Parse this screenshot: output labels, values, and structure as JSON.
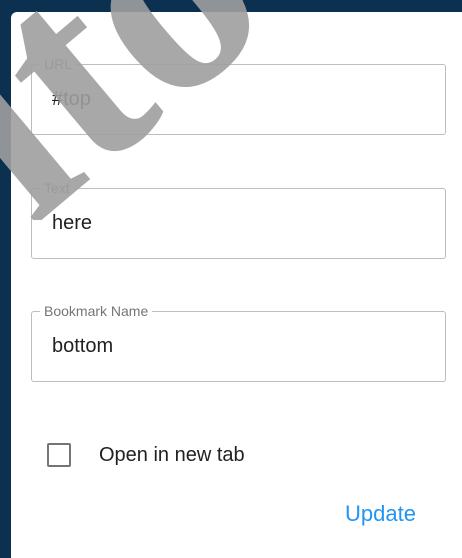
{
  "dialog": {
    "fields": [
      {
        "label": "URL",
        "value": "#top"
      },
      {
        "label": "Text",
        "value": "here"
      },
      {
        "label": "Bookmark Name",
        "value": "bottom"
      }
    ],
    "checkbox": {
      "label": "Open in new tab",
      "checked": false
    },
    "update_label": "Update"
  },
  "colors": {
    "background": "#0b3050",
    "accent": "#2196f3",
    "border": "#bdbdbd",
    "legend_text": "#757575"
  },
  "watermark": {
    "text": "iito"
  }
}
